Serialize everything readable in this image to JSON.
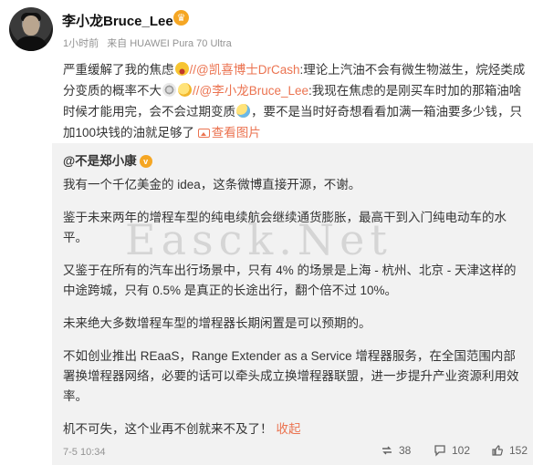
{
  "post": {
    "username": "李小龙Bruce_Lee",
    "time": "1小时前",
    "source": "来自 HUAWEI Pura 70 Ultra",
    "text_1": "严重缓解了我的焦虑",
    "mention_1": "//@凯喜博士DrCash",
    "text_2": ":理论上汽油不会有微生物滋生，烷烃类成分变质的概率不大",
    "mention_2": "//@李小龙Bruce_Lee",
    "text_3": ":我现在焦虑的是刚买车时加的那箱油啥时候才能用完，会不会过期变质",
    "text_4": "，要不是当时好奇想看看加满一箱油要多少钱，只加100块钱的油就足够了",
    "view_image": "查看图片"
  },
  "repost": {
    "author": "@不是郑小康",
    "paragraphs": [
      "我有一个千亿美金的 idea，这条微博直接开源，不谢。",
      "鉴于未来两年的增程车型的纯电续航会继续通货膨胀，最高干到入门纯电动车的水平。",
      "又鉴于在所有的汽车出行场景中，只有 4% 的场景是上海 - 杭州、北京 - 天津这样的中途跨城，只有 0.5% 是真正的长途出行，翻个倍不过 10%。",
      "未来绝大多数增程车型的增程器长期闲置是可以预期的。",
      "不如创业推出 REaaS，Range Extender as a Service 增程器服务，在全国范围内部署换增程器网络，必要的话可以牵头成立换增程器联盟，进一步提升产业资源利用效率。"
    ],
    "last_line": "机不可失，这个业再不创就来不及了！",
    "collapse": "收起",
    "time": "7-5 10:34",
    "repost_count": "38",
    "comment_count": "102",
    "like_count": "152"
  },
  "watermark": "Easck.Net",
  "colors": {
    "accent": "#eb7350",
    "vip": "#f5a623",
    "repost_bg": "#f2f2f2"
  },
  "icons": [
    "vip-crown-icon",
    "laugh-emoji-icon",
    "dizzy-emoji-icon",
    "think-emoji-icon",
    "sweat-emoji-icon",
    "image-icon",
    "repost-icon",
    "comment-icon",
    "like-icon"
  ]
}
